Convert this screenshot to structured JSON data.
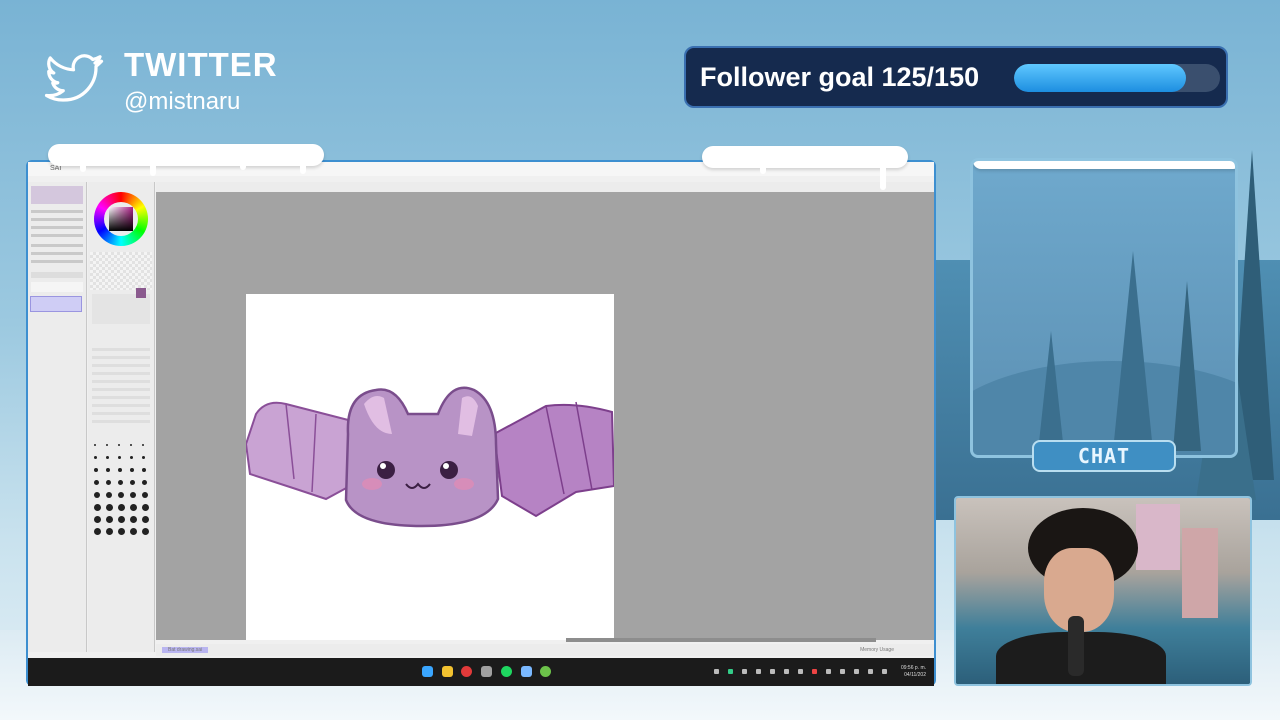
{
  "overlay": {
    "twitter_title": "TWITTER",
    "twitter_handle": "@mistnaru",
    "follower_goal_text": "Follower goal 125/150",
    "follower_current": 125,
    "follower_target": 150,
    "chat_label": "CHAT"
  },
  "app": {
    "title": "SAI",
    "status_left": "Bat drawing.sai",
    "statusbar_right": "Memory Usage",
    "clock_time": "09:56 p. m.",
    "clock_date": "04/11/202"
  },
  "icons": {
    "twitter": "twitter-bird-icon",
    "start": "windows-start-icon",
    "explorer": "file-explorer-icon",
    "spotify": "spotify-icon"
  },
  "colors": {
    "goal_fill": "#1d8ee0",
    "frame_border": "#3d8fd0",
    "bat_purple": "#a070b4"
  }
}
